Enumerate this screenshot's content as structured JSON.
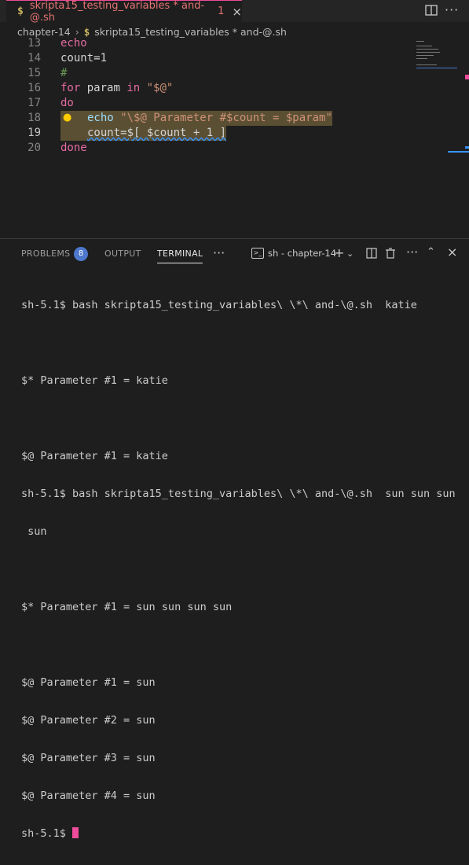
{
  "tab": {
    "icon": "$",
    "filename": "skripta15_testing_variables * and-@.sh",
    "problems_count": "1",
    "close": "×"
  },
  "breadcrumb": {
    "folder": "chapter-14",
    "icon": "$",
    "file": "skripta15_testing_variables * and-@.sh"
  },
  "editor": {
    "lines": [
      {
        "n": "13",
        "text": "echo"
      },
      {
        "n": "14",
        "text": "count=1"
      },
      {
        "n": "15",
        "text": "#"
      },
      {
        "n": "16",
        "kw": "for",
        "rest1": " param ",
        "kw2": "in",
        "str": " \"$@\""
      },
      {
        "n": "17",
        "text": "do"
      },
      {
        "n": "18",
        "cmd": "echo ",
        "str": "\"\\$@ Parameter #$count = $param\""
      },
      {
        "n": "19",
        "code": "count=$[ $count + 1 ]"
      },
      {
        "n": "20",
        "text": "done"
      }
    ]
  },
  "panel": {
    "tabs": [
      "PROBLEMS",
      "OUTPUT",
      "TERMINAL"
    ],
    "problems_badge": "8",
    "terminal_name": "sh - chapter-14"
  },
  "terminal": {
    "lines": [
      "sh-5.1$ bash skripta15_testing_variables\\ \\*\\ and-\\@.sh  katie",
      "",
      "$* Parameter #1 = katie",
      "",
      "$@ Parameter #1 = katie",
      "sh-5.1$ bash skripta15_testing_variables\\ \\*\\ and-\\@.sh  sun sun sun",
      " sun",
      "",
      "$* Parameter #1 = sun sun sun sun",
      "",
      "$@ Parameter #1 = sun",
      "$@ Parameter #2 = sun",
      "$@ Parameter #3 = sun",
      "$@ Parameter #4 = sun"
    ],
    "prompt": "sh-5.1$ "
  },
  "colors": {
    "accent": "#ee4c9a",
    "keyword": "#e56ba2",
    "string": "#ce9178",
    "badge": "#4d78cc"
  }
}
